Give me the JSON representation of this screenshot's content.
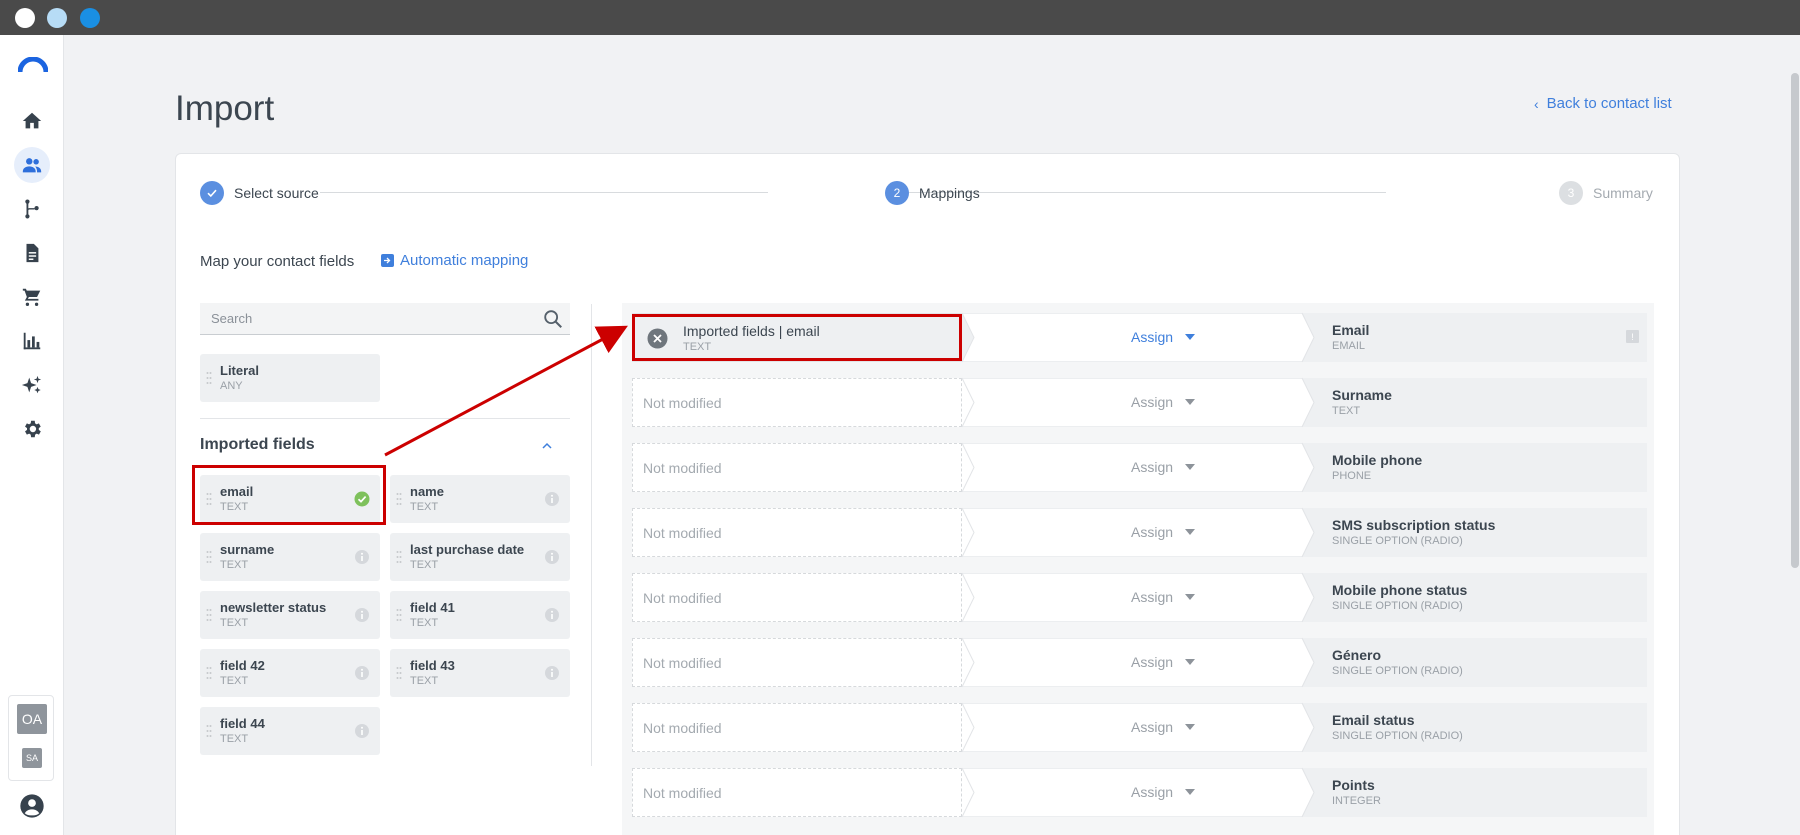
{
  "window": {
    "controls": [
      {
        "name": "close",
        "color": "#ffffff"
      },
      {
        "name": "minimize",
        "color": "#b7dcf6"
      },
      {
        "name": "maximize",
        "color": "#1a8fe3"
      }
    ]
  },
  "sidebar": {
    "items": [
      {
        "icon": "home-icon",
        "active": false
      },
      {
        "icon": "contacts-icon",
        "active": true
      },
      {
        "icon": "flow-icon",
        "active": false
      },
      {
        "icon": "document-icon",
        "active": false
      },
      {
        "icon": "cart-icon",
        "active": false
      },
      {
        "icon": "chart-icon",
        "active": false
      },
      {
        "icon": "sparkle-icon",
        "active": false
      },
      {
        "icon": "gear-icon",
        "active": false
      }
    ],
    "avatars": {
      "primary": "OA",
      "secondary": "SA"
    }
  },
  "header": {
    "title": "Import",
    "back_link": "Back to contact list"
  },
  "stepper": {
    "steps": [
      {
        "label": "Select source",
        "state": "done",
        "marker": ""
      },
      {
        "label": "Mappings",
        "state": "active",
        "marker": "2"
      },
      {
        "label": "Summary",
        "state": "pending",
        "marker": "3"
      }
    ]
  },
  "mapping": {
    "heading": "Map your contact fields",
    "auto_mapping": "Automatic mapping",
    "search_placeholder": "Search",
    "literal": {
      "name": "Literal",
      "type": "ANY"
    },
    "imported_heading": "Imported fields",
    "imported_fields": [
      {
        "name": "email",
        "type": "TEXT",
        "mapped": true
      },
      {
        "name": "name",
        "type": "TEXT",
        "mapped": false
      },
      {
        "name": "surname",
        "type": "TEXT",
        "mapped": false
      },
      {
        "name": "last purchase date",
        "type": "TEXT",
        "mapped": false
      },
      {
        "name": "newsletter status",
        "type": "TEXT",
        "mapped": false
      },
      {
        "name": "field 41",
        "type": "TEXT",
        "mapped": false
      },
      {
        "name": "field 42",
        "type": "TEXT",
        "mapped": false
      },
      {
        "name": "field 43",
        "type": "TEXT",
        "mapped": false
      },
      {
        "name": "field 44",
        "type": "TEXT",
        "mapped": false
      }
    ],
    "rows": [
      {
        "source": "Imported fields | email",
        "source_type": "TEXT",
        "assign": "Assign",
        "target": "Email",
        "target_type": "EMAIL",
        "filled": true,
        "required_badge": "!"
      },
      {
        "source": "Not modified",
        "source_type": "",
        "assign": "Assign",
        "target": "Surname",
        "target_type": "TEXT",
        "filled": false,
        "required_badge": ""
      },
      {
        "source": "Not modified",
        "source_type": "",
        "assign": "Assign",
        "target": "Mobile phone",
        "target_type": "PHONE",
        "filled": false,
        "required_badge": ""
      },
      {
        "source": "Not modified",
        "source_type": "",
        "assign": "Assign",
        "target": "SMS subscription status",
        "target_type": "SINGLE OPTION (RADIO)",
        "filled": false,
        "required_badge": ""
      },
      {
        "source": "Not modified",
        "source_type": "",
        "assign": "Assign",
        "target": "Mobile phone status",
        "target_type": "SINGLE OPTION (RADIO)",
        "filled": false,
        "required_badge": ""
      },
      {
        "source": "Not modified",
        "source_type": "",
        "assign": "Assign",
        "target": "Género",
        "target_type": "SINGLE OPTION (RADIO)",
        "filled": false,
        "required_badge": ""
      },
      {
        "source": "Not modified",
        "source_type": "",
        "assign": "Assign",
        "target": "Email status",
        "target_type": "SINGLE OPTION (RADIO)",
        "filled": false,
        "required_badge": ""
      },
      {
        "source": "Not modified",
        "source_type": "",
        "assign": "Assign",
        "target": "Points",
        "target_type": "INTEGER",
        "filled": false,
        "required_badge": ""
      }
    ]
  },
  "colors": {
    "accent": "#3f7fdc",
    "annotation": "#cc0000",
    "success": "#7ec15c"
  }
}
